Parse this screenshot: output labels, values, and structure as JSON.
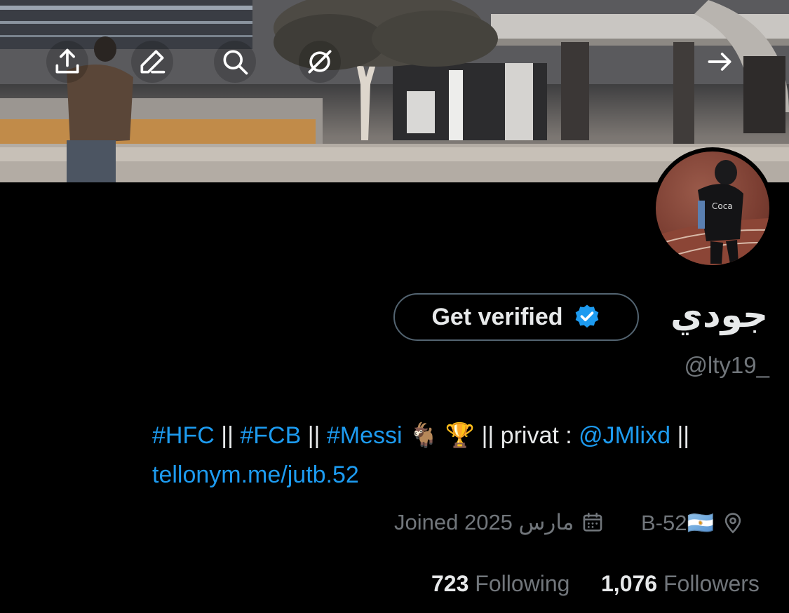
{
  "header": {
    "icons": [
      "share-icon",
      "edit-icon",
      "search-icon",
      "hide-icon",
      "forward-arrow-icon"
    ]
  },
  "profile": {
    "verify_label": "Get verified",
    "display_name": "جودي",
    "handle": "@lty19_"
  },
  "bio": {
    "tag1": "#HFC",
    "sep1": " || ",
    "tag2": "#FCB",
    "sep2": " || ",
    "tag3": "#Messi",
    "emoji": " 🐐 🏆 ",
    "text1": "|| privat : ",
    "mention": "@JMlixd",
    "text2": " ||",
    "url": "tellonym.me/jutb.52"
  },
  "meta": {
    "location": "B-52🇦🇷",
    "joined": "Joined 2025 مارس"
  },
  "stats": {
    "following_count": "723",
    "following_label": "Following",
    "followers_count": "1,076",
    "followers_label": "Followers"
  },
  "colors": {
    "accent": "#1d9bf0",
    "secondary_text": "#71767b",
    "background": "#000000"
  }
}
